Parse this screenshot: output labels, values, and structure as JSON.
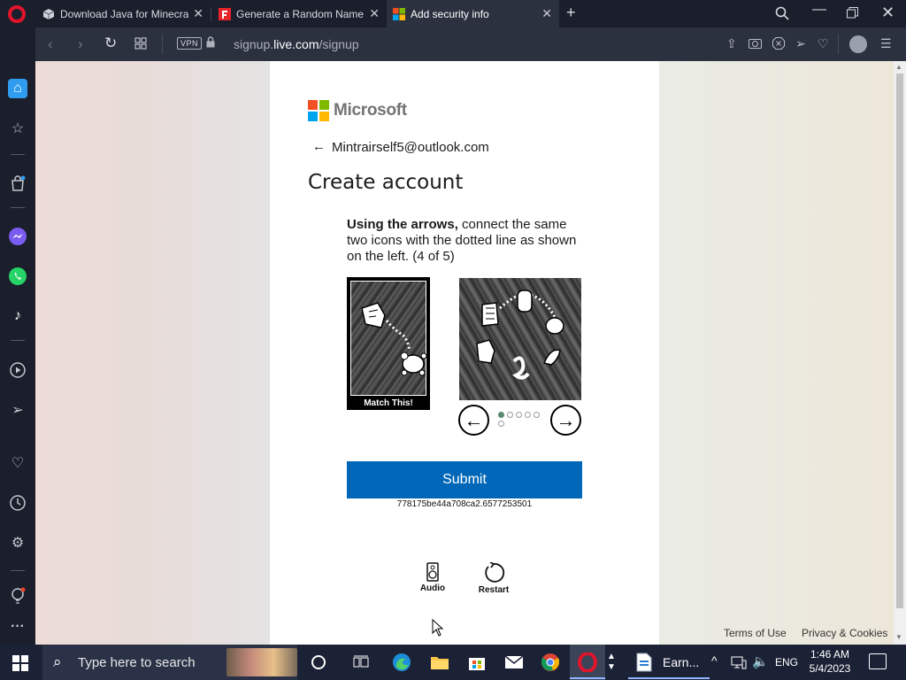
{
  "browser": {
    "tabs": [
      {
        "title": "Download Java for Minecraft",
        "favicon": "cube-favicon"
      },
      {
        "title": "Generate a Random Name",
        "favicon": "f-favicon"
      },
      {
        "title": "Add security info",
        "favicon": "microsoft-favicon",
        "active": true
      }
    ],
    "url_prefix": "signup.",
    "url_domain": "live.com",
    "url_path": "/signup",
    "vpn_label": "VPN"
  },
  "page": {
    "brand": "Microsoft",
    "email": "Mintrairself5@outlook.com",
    "heading": "Create account",
    "instruction_bold": "Using the arrows,",
    "instruction_rest": " connect the same two icons with the dotted line as shown on the left. (4 of 5)",
    "match_label": "Match This!",
    "submit_label": "Submit",
    "session_code": "778175be44a708ca2.6577253501",
    "audio_label": "Audio",
    "restart_label": "Restart",
    "terms_label": "Terms of Use",
    "privacy_label": "Privacy & Cookies"
  },
  "taskbar": {
    "search_placeholder": "Type here to search",
    "pinned_label": "Earn...",
    "language": "ENG",
    "time": "1:46 AM",
    "date": "5/4/2023"
  },
  "colors": {
    "submit_blue": "#0067b8",
    "opera_red": "#e0142b",
    "ms_red": "#f25022",
    "ms_green": "#7fba00",
    "ms_blue": "#00a4ef",
    "ms_yellow": "#ffb900"
  }
}
